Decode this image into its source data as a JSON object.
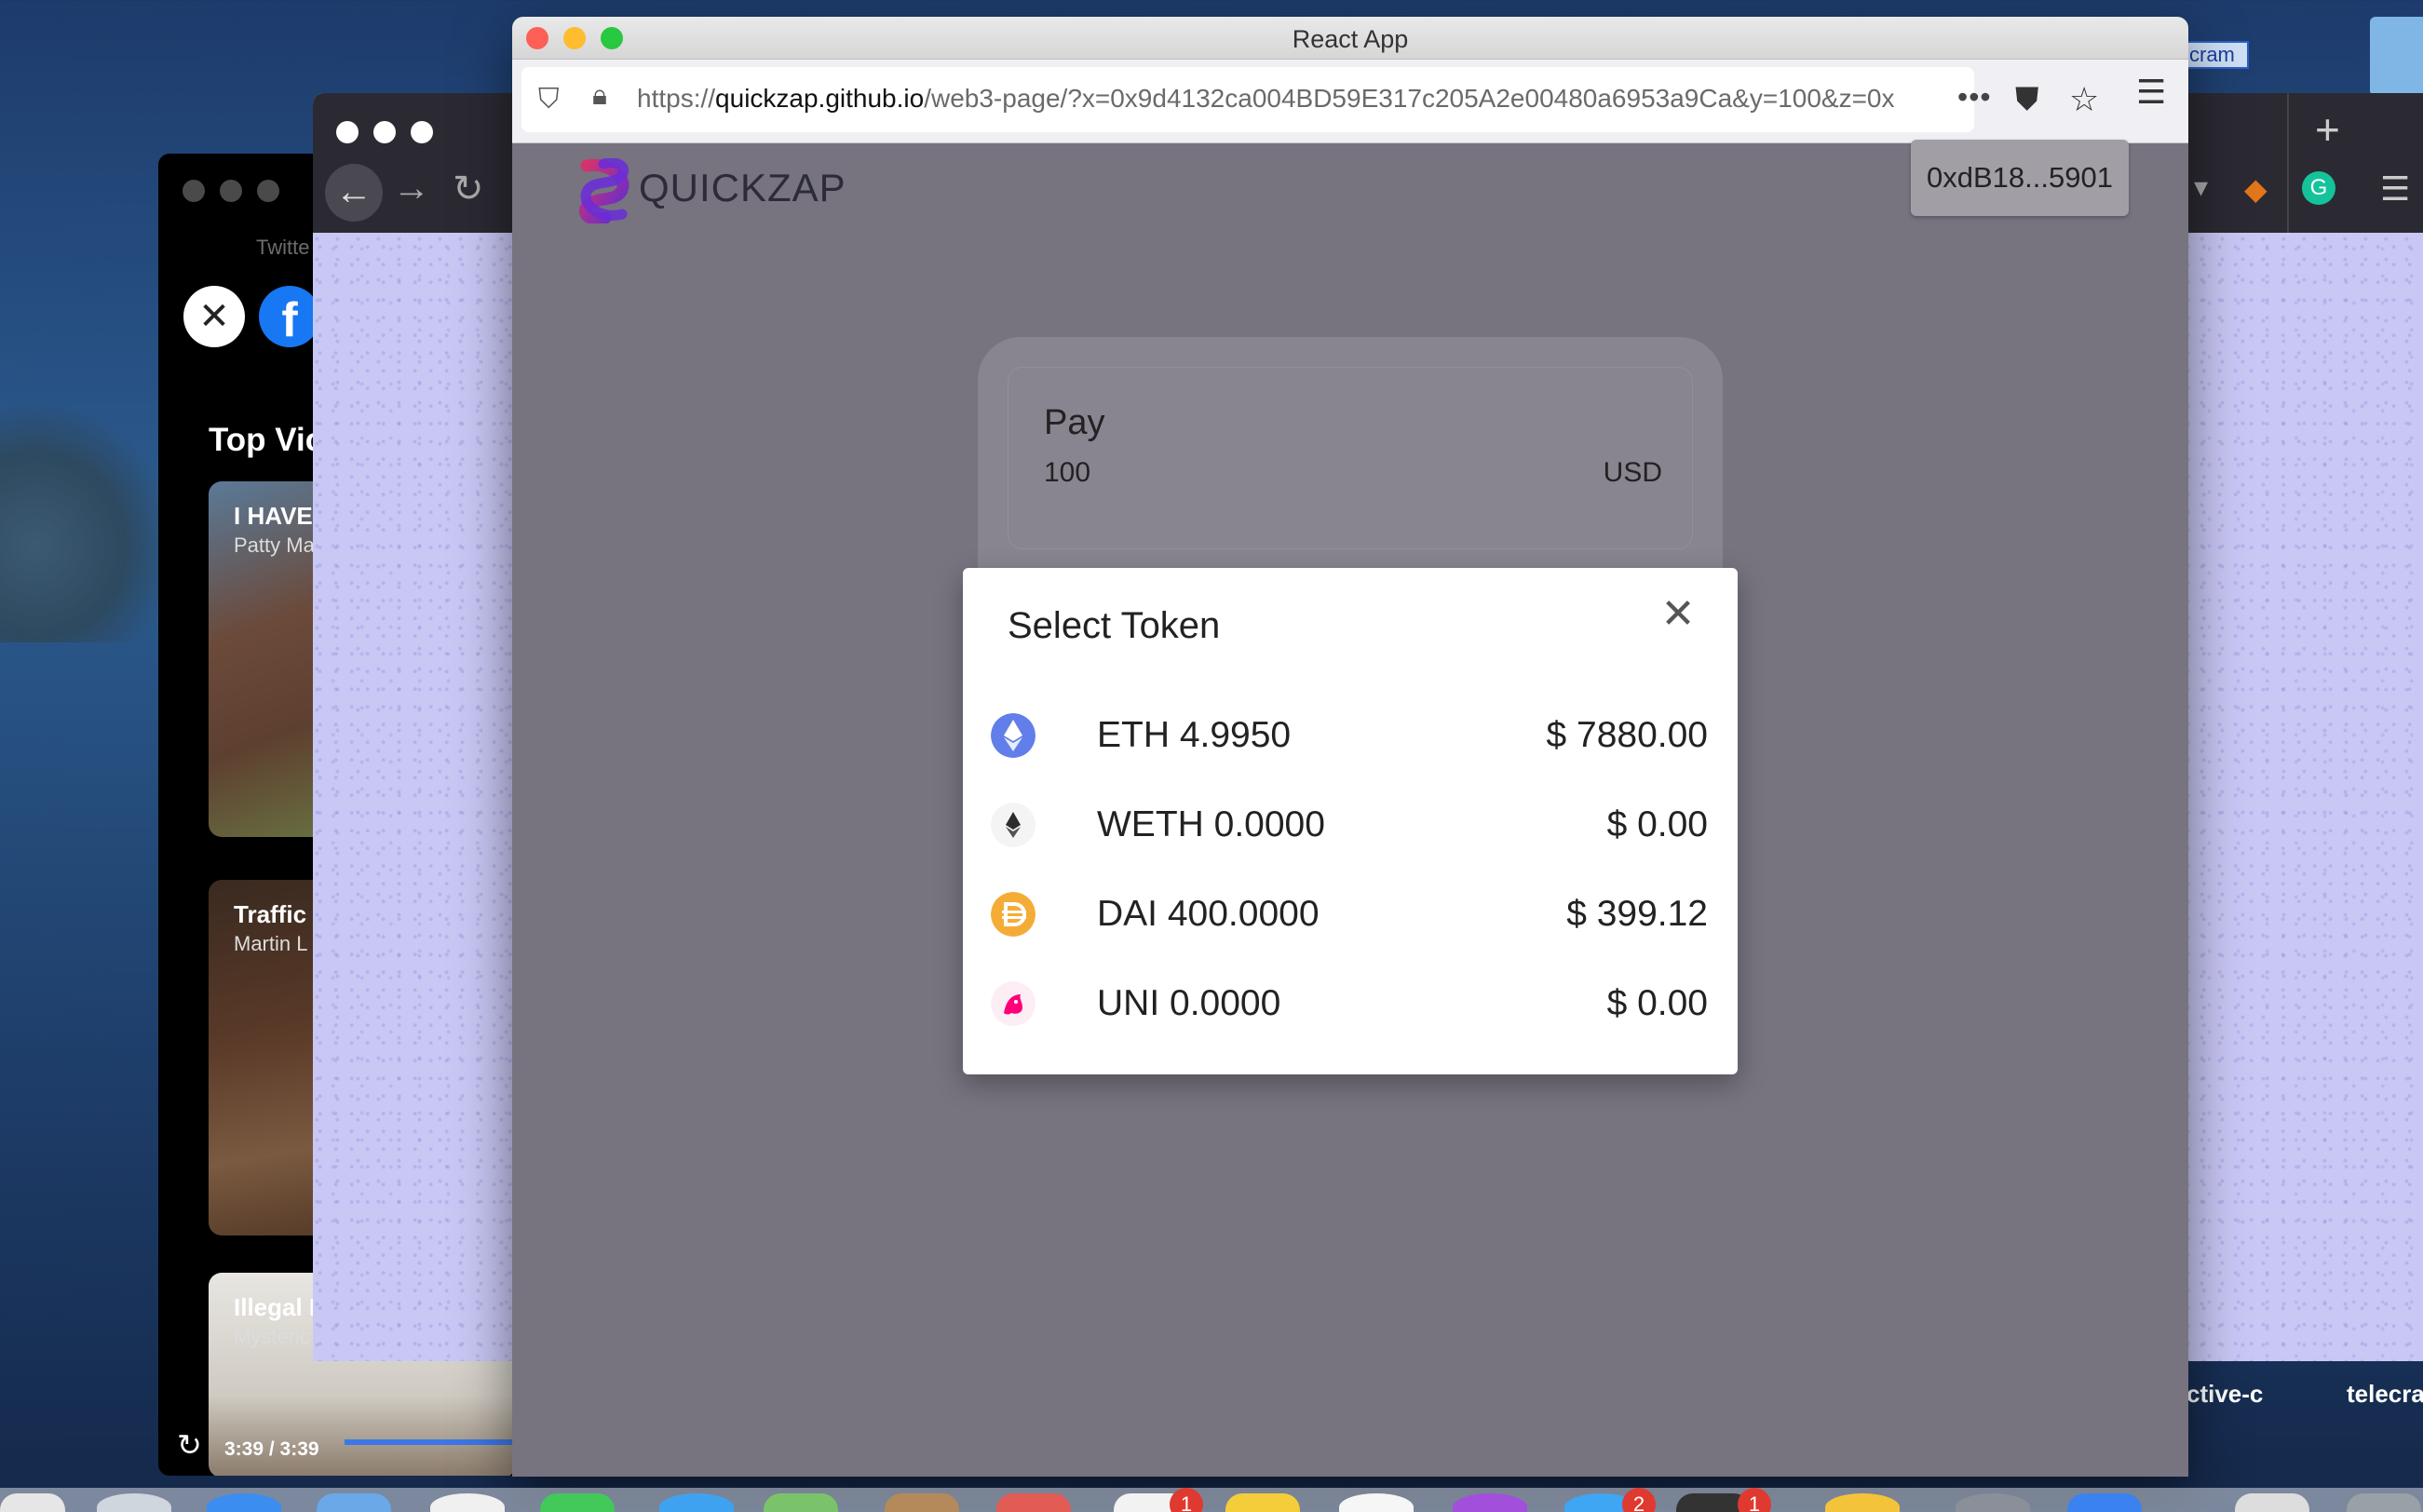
{
  "front_window": {
    "title": "React App",
    "url_prefix": "https://",
    "url_host": "quickzap.github.io",
    "url_path": "/web3-page/?x=0x9d4132ca004BD59E317c205A2e00480a6953a9Ca&y=100&z=0x",
    "url_more": "•••"
  },
  "app": {
    "logo_text": "QUICKZAP",
    "wallet_address": "0xdB18...5901",
    "pay": {
      "label": "Pay",
      "amount": "100",
      "currency": "USD"
    }
  },
  "modal": {
    "title": "Select Token",
    "close_symbol": "✕",
    "tokens": [
      {
        "name": "ETH 4.9950",
        "value": "$ 7880.00",
        "icon": "eth-icon",
        "color": "#627eea"
      },
      {
        "name": "WETH 0.0000",
        "value": "$ 0.00",
        "icon": "weth-icon",
        "color": "#2c2c2c"
      },
      {
        "name": "DAI 400.0000",
        "value": "$ 399.12",
        "icon": "dai-icon",
        "color": "#f5ac37"
      },
      {
        "name": "UNI 0.0000",
        "value": "$ 0.00",
        "icon": "uni-icon",
        "color": "#ff007a"
      }
    ]
  },
  "back_window": {
    "tab_label": "Twitte",
    "section_title": "Top Vic",
    "videos": [
      {
        "title": "I HAVE",
        "subtitle": "Patty Ma"
      },
      {
        "title": "Traffic",
        "subtitle": "Martin L"
      },
      {
        "title": "Illegal I",
        "subtitle": "Mysteric"
      }
    ],
    "time": "3:39 / 3:39"
  },
  "mid_window": {
    "bottom_left_text": "ctive-c",
    "bottom_right_text": "telecra"
  },
  "desktop": {
    "folder_label": "cram"
  },
  "dock": {
    "badges": [
      "1",
      "2",
      "1"
    ]
  }
}
